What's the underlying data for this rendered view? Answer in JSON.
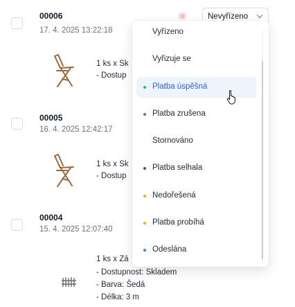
{
  "orders": [
    {
      "id": "00006",
      "date": "17. 4. 2025 13:22:18",
      "item_lines": [
        "1 ks x Sk",
        "- Dostup"
      ],
      "image_icon": "wooden-chair-icon"
    },
    {
      "id": "00005",
      "date": "16. 4. 2025 12:42:17",
      "item_lines": [
        "1 ks x Sk",
        "- Dostup"
      ],
      "image_icon": "wooden-chair-icon"
    },
    {
      "id": "00004",
      "date": "15. 4. 2025 12:07:40",
      "item_lines": [
        "1 ks x Zá",
        "- Dostupnost: Skladem",
        "- Barva: Šedá",
        "- Délka: 3 m"
      ],
      "image_icon": "fence-panel-icon"
    }
  ],
  "status_filter": {
    "selected_label": "Nevyřízeno",
    "options": [
      {
        "label": "Vyřízeno",
        "dot_color": ""
      },
      {
        "label": "Vyřizuje se",
        "dot_color": ""
      },
      {
        "label": "Platba úspěšná",
        "dot_color": "#22c55e",
        "highlighted": true
      },
      {
        "label": "Platba zrušena",
        "dot_color": "#6b7280"
      },
      {
        "label": "Stornováno",
        "dot_color": ""
      },
      {
        "label": "Platba selhala",
        "dot_color": "#4b5563"
      },
      {
        "label": "Nedořešená",
        "dot_color": "#eab308"
      },
      {
        "label": "Platba probíhá",
        "dot_color": "#eab308"
      },
      {
        "label": "Odeslána",
        "dot_color": "#3b82f6"
      }
    ]
  },
  "colors": {
    "accent": "#2563eb",
    "highlight_bg": "#eef4fd",
    "clear_icon": "#ef9a9a"
  }
}
